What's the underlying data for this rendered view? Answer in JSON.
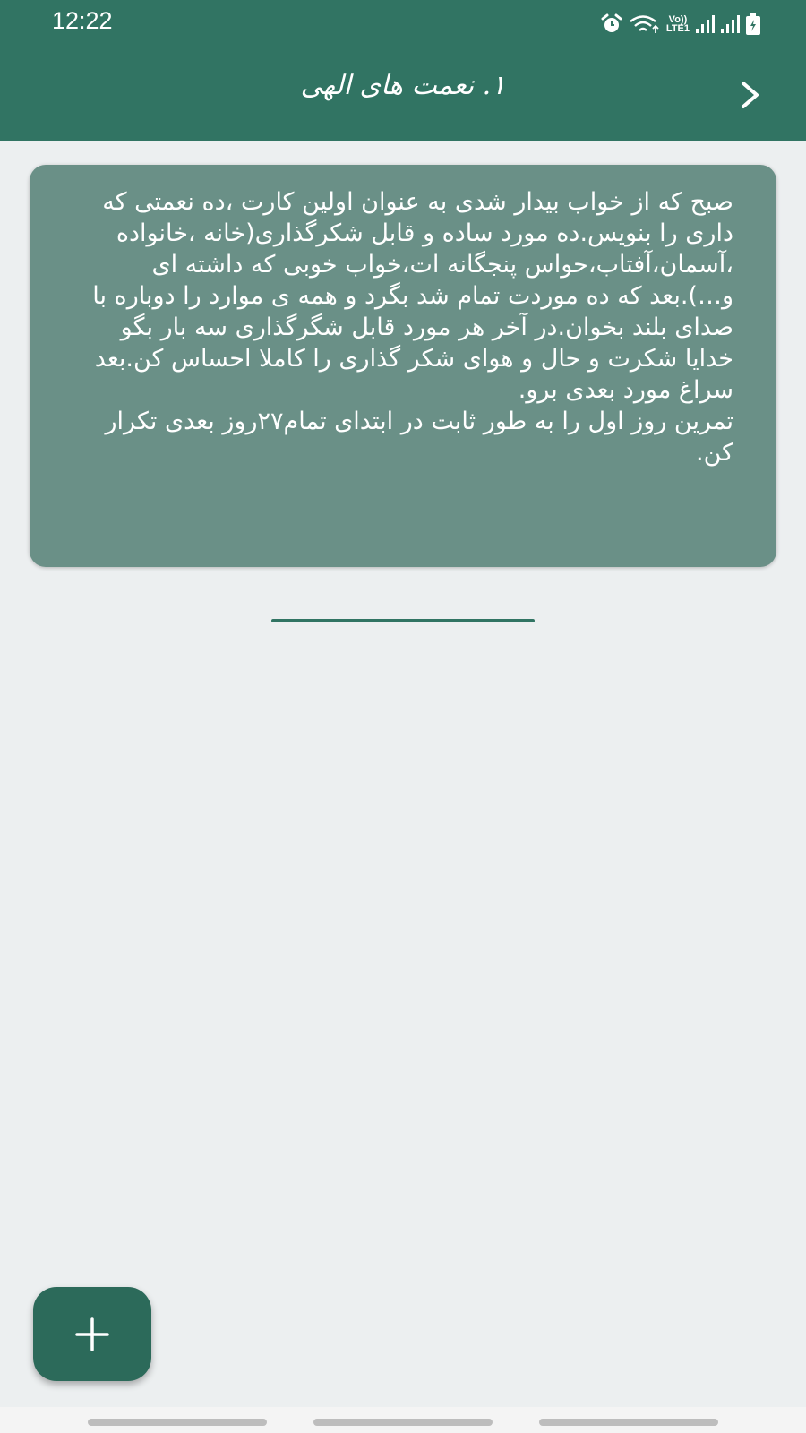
{
  "status_bar": {
    "time": "12:22",
    "icons": [
      "alarm-icon",
      "wifi-icon",
      "volte-icon",
      "signal-icon",
      "signal-icon",
      "battery-icon"
    ],
    "volte_top": "Vo))",
    "volte_bottom": "LTE1"
  },
  "header": {
    "title": "۱. نعمت های الهی",
    "back_icon": "chevron-right-icon",
    "background": "#317463"
  },
  "card": {
    "text": "صبح که از خواب بیدار شدی به عنوان اولین کارت ،ده نعمتی که داری را بنویس.ده مورد ساده و قابل شکرگذاری(خانه ،خانواده ،آسمان،آفتاب،حواس پنجگانه ات،خواب خوبی که داشته ای و…).بعد که ده موردت تمام شد بگرد و همه ی موارد را دوباره با صدای بلند بخوان.در آخر هر مورد قابل شگرگذاری سه بار بگو خدایا شکرت و حال و هوای شکر گذاری را کاملا احساس کن.بعد سراغ مورد بعدی برو.\nتمرین روز اول را به طور ثابت در ابتدای تمام۲۷روز بعدی تکرار کن.",
    "background": "#6A9087"
  },
  "fab": {
    "icon": "plus-icon",
    "background": "#2C6A5A"
  }
}
